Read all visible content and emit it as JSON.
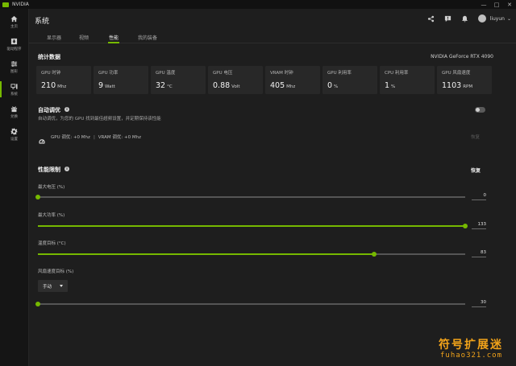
{
  "app": {
    "title": "NVIDIA",
    "brand_color": "#76b900"
  },
  "window_controls": [
    "—",
    "□",
    "✕"
  ],
  "nav": [
    {
      "label": "主页",
      "icon": "home-icon",
      "active": false
    },
    {
      "label": "驱动程序",
      "icon": "driver-download-icon",
      "active": false
    },
    {
      "label": "图形",
      "icon": "graphics-sliders-icon",
      "active": false
    },
    {
      "label": "系统",
      "icon": "system-monitor-icon",
      "active": true
    },
    {
      "label": "兑换",
      "icon": "gift-icon",
      "active": false
    },
    {
      "label": "设置",
      "icon": "gear-icon",
      "active": false
    }
  ],
  "header": {
    "title": "系统",
    "username": "liuyun"
  },
  "tabs": [
    {
      "label": "显示器",
      "active": false
    },
    {
      "label": "视频",
      "active": false
    },
    {
      "label": "性能",
      "active": true
    },
    {
      "label": "我的装备",
      "active": false
    }
  ],
  "stats": {
    "title": "统计数据",
    "gpu_name": "NVIDIA GeForce RTX 4090",
    "items": [
      {
        "label": "GPU 时钟",
        "value": "210",
        "unit": "Mhz"
      },
      {
        "label": "GPU 功率",
        "value": "9",
        "unit": "Watt"
      },
      {
        "label": "GPU 温度",
        "value": "32",
        "unit": "°C"
      },
      {
        "label": "GPU 电压",
        "value": "0.88",
        "unit": "Volt"
      },
      {
        "label": "VRAM 时钟",
        "value": "405",
        "unit": "Mhz"
      },
      {
        "label": "GPU 利用率",
        "value": "0",
        "unit": "%"
      },
      {
        "label": "CPU 利用率",
        "value": "1",
        "unit": "%"
      },
      {
        "label": "GPU 风扇速度",
        "value": "1103",
        "unit": "RPM"
      }
    ]
  },
  "auto_tune": {
    "title": "自动调优",
    "description": "自动调优，为您的 GPU 找到最佳超频设置，并定期保持该性能",
    "enabled": false,
    "gpu_tune": "GPU 调优: +0 Mhz",
    "vram_tune": "VRAM 调优: +0 Mhz",
    "separator": "|",
    "reset_label": "恢复"
  },
  "limits": {
    "title": "性能限制",
    "reset_label": "恢复",
    "sliders": [
      {
        "label": "最大电压 (%)",
        "value": "0",
        "position": 0.0
      },
      {
        "label": "最大功率 (%)",
        "value": "133",
        "position": 1.0
      },
      {
        "label": "温度目标 (°C)",
        "value": "83",
        "position": 0.787
      },
      {
        "label": "风扇速度目标 (%)",
        "value": "30",
        "position": 0.0
      }
    ],
    "fan_mode": "手动"
  },
  "watermark": {
    "text": "符号扩展迷",
    "url": "fuhao321.com"
  }
}
